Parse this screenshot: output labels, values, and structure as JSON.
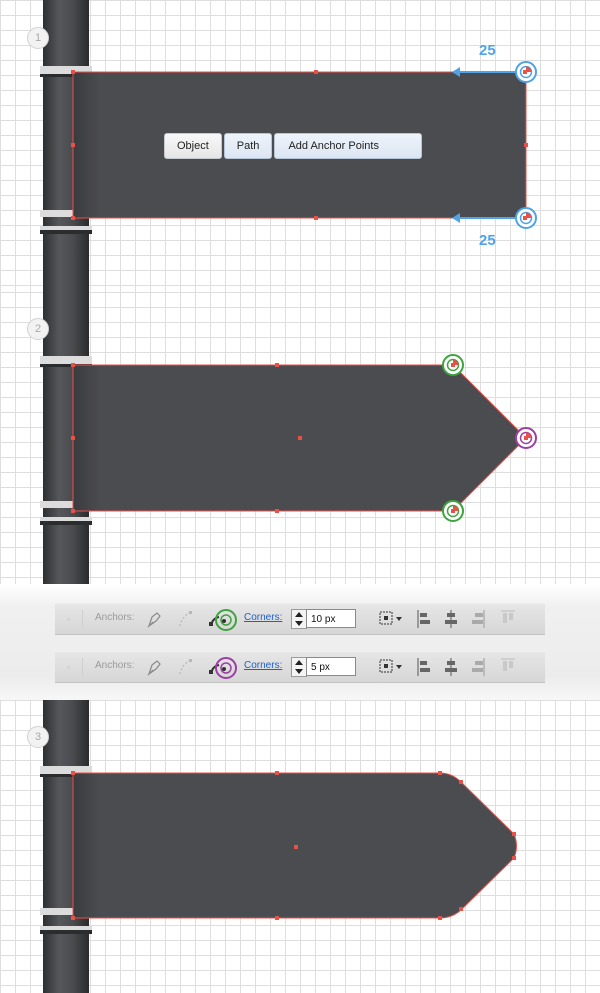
{
  "steps": [
    {
      "number": "1"
    },
    {
      "number": "2"
    },
    {
      "number": "3"
    }
  ],
  "context_menu": {
    "items": [
      "Object",
      "Path",
      "Add Anchor Points"
    ]
  },
  "dimensions": {
    "top_offset": "25",
    "bottom_offset": "25"
  },
  "toolbar_rows": [
    {
      "anchors_label": "Anchors:",
      "corners_label": "Corners:",
      "corner_value": "10 px",
      "highlight_color": "#3fa33f"
    },
    {
      "anchors_label": "Anchors:",
      "corners_label": "Corners:",
      "corner_value": "5 px",
      "highlight_color": "#9b3fa6"
    }
  ],
  "colors": {
    "sign": "#4b4c4f",
    "selection": "#e8504a",
    "accent_blue": "#4fa3e6",
    "green_marker": "#3fa33f",
    "purple_marker": "#9b3fa6",
    "pole": "#3f4043"
  },
  "icons": [
    "pen-icon",
    "convert-anchor-icon",
    "corner-widget-icon",
    "spinner-icon",
    "transform-grid-icon",
    "align-left-icon",
    "align-center-icon",
    "align-right-icon",
    "align-top-icon"
  ]
}
